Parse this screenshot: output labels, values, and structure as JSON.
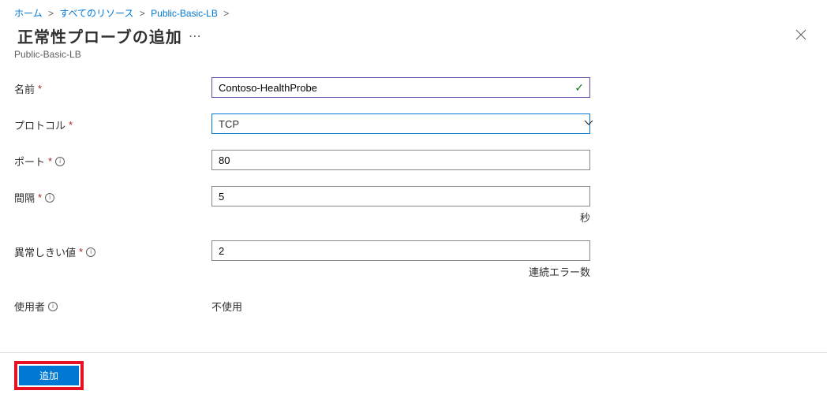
{
  "breadcrumb": {
    "home": "ホーム",
    "all_resources": "すべてのリソース",
    "resource": "Public-Basic-LB"
  },
  "header": {
    "title": "正常性プローブの追加",
    "subtitle": "Public-Basic-LB"
  },
  "form": {
    "name": {
      "label": "名前",
      "value": "Contoso-HealthProbe"
    },
    "protocol": {
      "label": "プロトコル",
      "value": "TCP"
    },
    "port": {
      "label": "ポート",
      "value": "80"
    },
    "interval": {
      "label": "間隔",
      "value": "5",
      "suffix": "秒"
    },
    "threshold": {
      "label": "異常しきい値",
      "value": "2",
      "suffix": "連続エラー数"
    },
    "used_by": {
      "label": "使用者",
      "value": "不使用"
    }
  },
  "footer": {
    "add": "追加"
  }
}
